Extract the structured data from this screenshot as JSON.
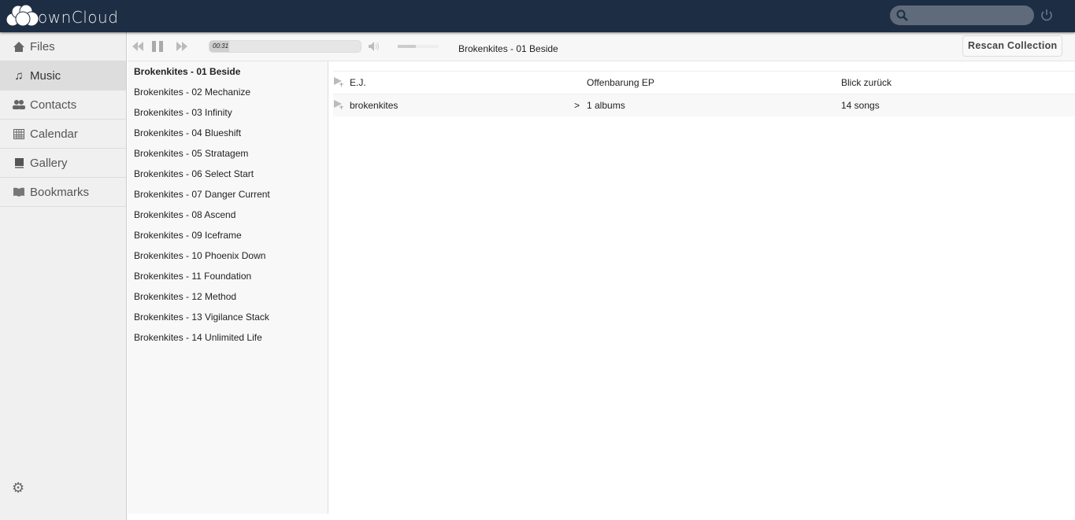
{
  "header": {
    "logo_text": "ownCloud",
    "search_placeholder": ""
  },
  "nav": {
    "items": [
      {
        "label": "Files",
        "icon": "home-icon"
      },
      {
        "label": "Music",
        "icon": "music-icon",
        "active": true
      },
      {
        "label": "Contacts",
        "icon": "contacts-icon"
      },
      {
        "label": "Calendar",
        "icon": "calendar-icon"
      },
      {
        "label": "Gallery",
        "icon": "gallery-icon"
      },
      {
        "label": "Bookmarks",
        "icon": "bookmarks-icon"
      }
    ]
  },
  "player": {
    "elapsed": "00:31",
    "progress_percent": 13,
    "volume_percent": 45,
    "now_playing": "Brokenkites - 01 Beside",
    "rescan_label": "Rescan Collection"
  },
  "playlist": [
    "Brokenkites - 01 Beside",
    "Brokenkites - 02 Mechanize",
    "Brokenkites - 03 Infinity",
    "Brokenkites - 04 Blueshift",
    "Brokenkites - 05 Stratagem",
    "Brokenkites - 06 Select Start",
    "Brokenkites - 07 Danger Current",
    "Brokenkites - 08 Ascend",
    "Brokenkites - 09 Iceframe",
    "Brokenkites - 10 Phoenix Down",
    "Brokenkites - 11 Foundation",
    "Brokenkites - 12 Method",
    "Brokenkites - 13 Vigilance Stack",
    "Brokenkites - 14 Unlimited Life"
  ],
  "artists": [
    {
      "name": "E.J.",
      "expand": "",
      "album": "Offenbarung EP",
      "song": "Blick zurück"
    },
    {
      "name": "brokenkites",
      "expand": ">",
      "album": "1 albums",
      "song": "14 songs"
    }
  ]
}
